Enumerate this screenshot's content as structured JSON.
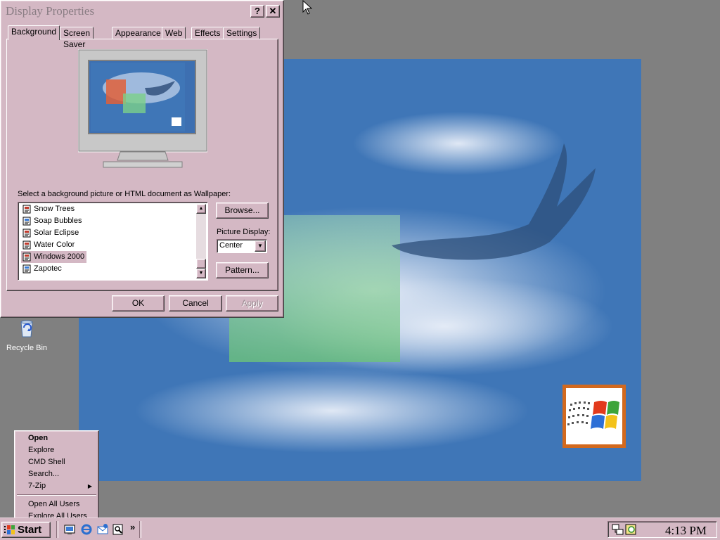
{
  "window": {
    "title": "Display Properties",
    "help_button": "?",
    "close_button": "✕"
  },
  "tabs": [
    {
      "label": "Background",
      "active": true
    },
    {
      "label": "Screen Saver"
    },
    {
      "label": "Appearance"
    },
    {
      "label": "Web"
    },
    {
      "label": "Effects"
    },
    {
      "label": "Settings"
    }
  ],
  "wallpaper_prompt": "Select a background picture or HTML document as Wallpaper:",
  "wallpaper_list": [
    {
      "label": "Snow Trees",
      "icon": "html-document-icon"
    },
    {
      "label": "Soap Bubbles",
      "icon": "html-document-icon"
    },
    {
      "label": "Solar Eclipse",
      "icon": "html-document-icon"
    },
    {
      "label": "Water Color",
      "icon": "html-document-icon"
    },
    {
      "label": "Windows 2000",
      "icon": "html-document-icon",
      "selected": true
    },
    {
      "label": "Zapotec",
      "icon": "html-document-icon"
    }
  ],
  "browse_button": "Browse...",
  "picture_display": {
    "label": "Picture Display:",
    "value": "Center"
  },
  "pattern_button": "Pattern...",
  "footer": {
    "ok": "OK",
    "cancel": "Cancel",
    "apply": "Apply"
  },
  "desktop_icons": [
    {
      "label": "Recycle Bin",
      "icon": "recycle-bin-icon"
    }
  ],
  "context_menu": {
    "items": [
      {
        "label": "Open",
        "bold": true
      },
      {
        "label": "Explore"
      },
      {
        "label": "CMD Shell"
      },
      {
        "label": "Search..."
      },
      {
        "label": "7-Zip",
        "submenu": true
      },
      {
        "separator": true
      },
      {
        "label": "Open All Users"
      },
      {
        "label": "Explore All Users"
      }
    ],
    "submenu_arrow": "▶"
  },
  "taskbar": {
    "start_label": "Start",
    "quick_launch": [
      "show-desktop-icon",
      "ie-icon",
      "outlook-icon",
      "search-icon"
    ],
    "chevron": "»",
    "clock": "4:13 PM"
  },
  "colors": {
    "face": "#d4b8c4",
    "desktop": "#808080",
    "wallpaper_blue": "#3f76b7"
  }
}
